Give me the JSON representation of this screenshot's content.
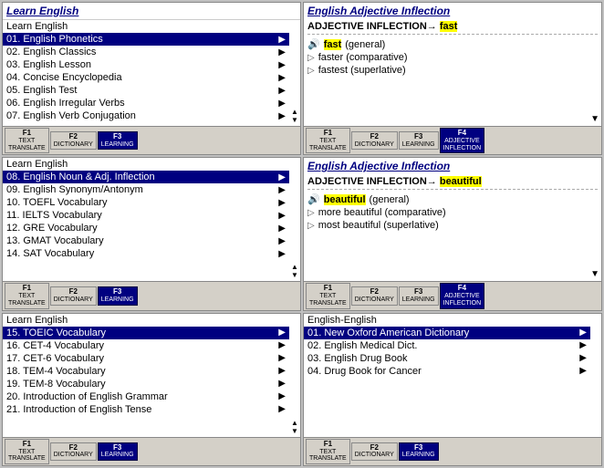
{
  "panels": {
    "top_left": {
      "title": "Learn English",
      "subtitle": "Learn English",
      "items": [
        {
          "num": "01.",
          "label": "English Phonetics",
          "selected": true
        },
        {
          "num": "02.",
          "label": "English Classics",
          "selected": false
        },
        {
          "num": "03.",
          "label": "English Lesson",
          "selected": false
        },
        {
          "num": "04.",
          "label": "Concise Encyclopedia",
          "selected": false
        },
        {
          "num": "05.",
          "label": "English Test",
          "selected": false
        },
        {
          "num": "06.",
          "label": "English Irregular Verbs",
          "selected": false
        },
        {
          "num": "07.",
          "label": "English Verb Conjugation",
          "selected": false
        }
      ],
      "toolbar": [
        {
          "f": "F1",
          "label": "TEXT\nTRANSLATE",
          "active": false
        },
        {
          "f": "F2",
          "label": "DICTIONARY",
          "active": false
        },
        {
          "f": "F3",
          "label": "LEARNING",
          "active": true
        },
        {
          "f": "",
          "label": "",
          "active": false
        }
      ]
    },
    "middle_left": {
      "subtitle": "Learn English",
      "items": [
        {
          "num": "08.",
          "label": "English Noun & Adj. Inflection",
          "selected": true
        },
        {
          "num": "09.",
          "label": "English Synonym/Antonym",
          "selected": false
        },
        {
          "num": "10.",
          "label": "TOEFL Vocabulary",
          "selected": false
        },
        {
          "num": "11.",
          "label": "IELTS Vocabulary",
          "selected": false
        },
        {
          "num": "12.",
          "label": "GRE Vocabulary",
          "selected": false
        },
        {
          "num": "13.",
          "label": "GMAT Vocabulary",
          "selected": false
        },
        {
          "num": "14.",
          "label": "SAT Vocabulary",
          "selected": false
        }
      ],
      "toolbar": [
        {
          "f": "F1",
          "label": "TEXT\nTRANSLATE",
          "active": false
        },
        {
          "f": "F2",
          "label": "DICTIONARY",
          "active": false
        },
        {
          "f": "F3",
          "label": "LEARNING",
          "active": true
        },
        {
          "f": "",
          "label": "",
          "active": false
        }
      ]
    },
    "bottom_left": {
      "subtitle": "Learn English",
      "items": [
        {
          "num": "15.",
          "label": "TOEIC Vocabulary",
          "selected": true
        },
        {
          "num": "16.",
          "label": "CET-4 Vocabulary",
          "selected": false
        },
        {
          "num": "17.",
          "label": "CET-6 Vocabulary",
          "selected": false
        },
        {
          "num": "18.",
          "label": "TEM-4 Vocabulary",
          "selected": false
        },
        {
          "num": "19.",
          "label": "TEM-8 Vocabulary",
          "selected": false
        },
        {
          "num": "20.",
          "label": "Introduction of English Grammar",
          "selected": false
        },
        {
          "num": "21.",
          "label": "Introduction of English Tense",
          "selected": false
        }
      ],
      "toolbar": [
        {
          "f": "F1",
          "label": "TEXT\nTRANSLATE",
          "active": false
        },
        {
          "f": "F2",
          "label": "DICTIONARY",
          "active": false
        },
        {
          "f": "F3",
          "label": "LEARNING",
          "active": true
        },
        {
          "f": "",
          "label": "",
          "active": false
        }
      ]
    },
    "top_right": {
      "header": "English Adjective Inflection",
      "inflection_label": "ADJECTIVE INFLECTION",
      "arrow": "→",
      "word": "fast",
      "items": [
        {
          "type": "general",
          "icon": "🔊",
          "text": "fast (general)",
          "highlight": true
        },
        {
          "type": "comparative",
          "icon": "▷",
          "text": "faster (comparative)",
          "highlight": false
        },
        {
          "type": "superlative",
          "icon": "▷",
          "text": "fastest (superlative)",
          "highlight": false
        }
      ],
      "toolbar": [
        {
          "f": "F1",
          "label": "TEXT\nTRANSLATE",
          "active": false
        },
        {
          "f": "F2",
          "label": "DICTIONARY",
          "active": false
        },
        {
          "f": "F3",
          "label": "LEARNING",
          "active": false
        },
        {
          "f": "F4",
          "label": "ADJECTIVE\nINFLECTION",
          "active": true
        }
      ]
    },
    "middle_right": {
      "header": "English Adjective Inflection",
      "inflection_label": "ADJECTIVE INFLECTION",
      "arrow": "→",
      "word": "beautiful",
      "items": [
        {
          "type": "general",
          "icon": "🔊",
          "text": "beautiful (general)",
          "highlight": true
        },
        {
          "type": "comparative",
          "icon": "▷",
          "text": "more beautiful (comparative)",
          "highlight": false
        },
        {
          "type": "superlative",
          "icon": "▷",
          "text": "most beautiful (superlative)",
          "highlight": false
        }
      ],
      "toolbar": [
        {
          "f": "F1",
          "label": "TEXT\nTRANSLATE",
          "active": false
        },
        {
          "f": "F2",
          "label": "DICTIONARY",
          "active": false
        },
        {
          "f": "F3",
          "label": "LEARNING",
          "active": false
        },
        {
          "f": "F4",
          "label": "ADJECTIVE\nINFLECTION",
          "active": true
        }
      ]
    },
    "bottom_right": {
      "subtitle": "English-English",
      "items": [
        {
          "num": "01.",
          "label": "New Oxford American Dictionary",
          "selected": true
        },
        {
          "num": "02.",
          "label": "English Medical Dict.",
          "selected": false
        },
        {
          "num": "03.",
          "label": "English Drug Book",
          "selected": false
        },
        {
          "num": "04.",
          "label": "Drug Book for Cancer",
          "selected": false
        }
      ],
      "toolbar": [
        {
          "f": "F1",
          "label": "TEXT\nTRANSLATE",
          "active": false
        },
        {
          "f": "F2",
          "label": "DICTIONARY",
          "active": false
        },
        {
          "f": "F3",
          "label": "LEARNING",
          "active": true
        },
        {
          "f": "",
          "label": "",
          "active": false
        }
      ]
    }
  }
}
